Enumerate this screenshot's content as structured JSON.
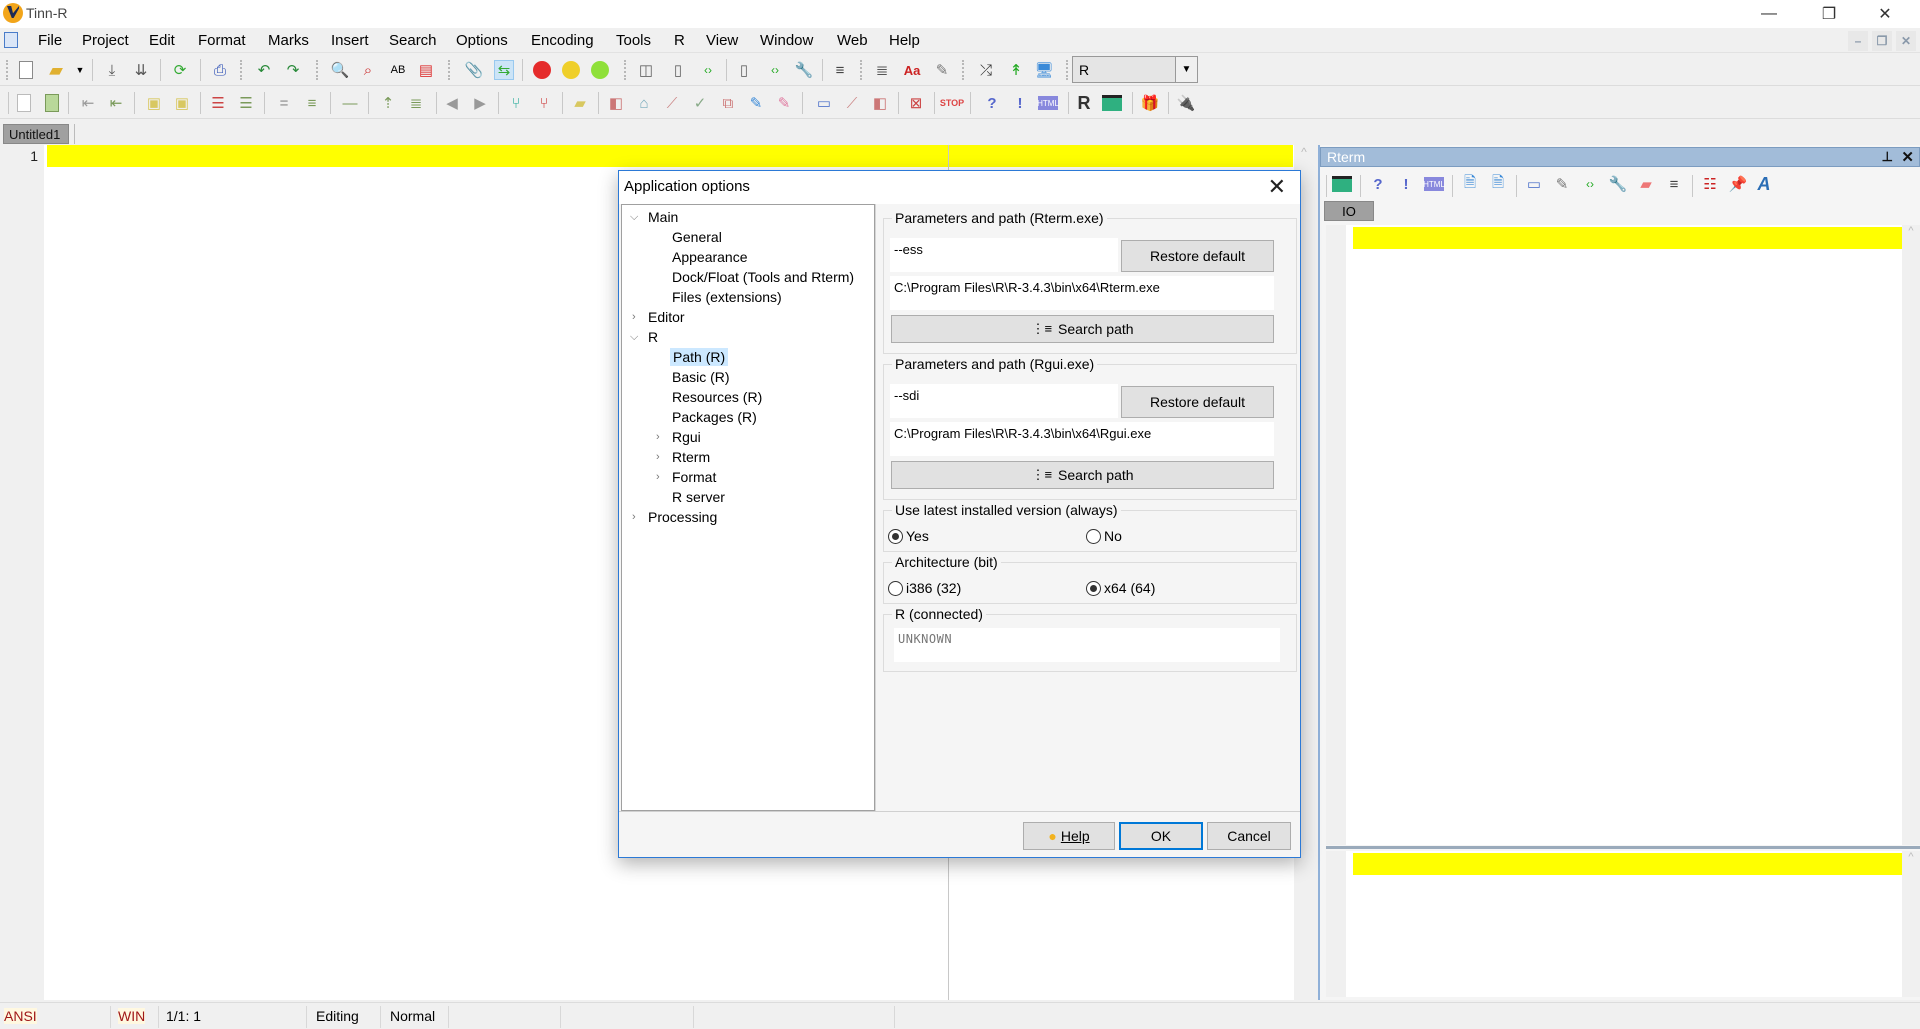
{
  "window": {
    "title": "Tinn-R",
    "minimize": "—",
    "restore": "❐",
    "close": "✕"
  },
  "menubar": {
    "items": [
      "File",
      "Project",
      "Edit",
      "Format",
      "Marks",
      "Insert",
      "Search",
      "Options",
      "Encoding",
      "Tools",
      "R",
      "View",
      "Window",
      "Web",
      "Help"
    ],
    "mdi": {
      "minimize": "–",
      "restore": "❐",
      "close": "✕"
    }
  },
  "toolbar1": {
    "r_combo_value": "R"
  },
  "tabs": [
    {
      "label": "Untitled1"
    }
  ],
  "editor": {
    "line_number": "1"
  },
  "rterm": {
    "title": "Rterm",
    "io_tab": "IO",
    "pin": "⊥",
    "close": "✕"
  },
  "statusbar": {
    "encoding": "ANSI",
    "eol": "WIN",
    "position": "1/1: 1",
    "mode": "Editing",
    "state": "Normal"
  },
  "dialog": {
    "title": "Application options",
    "tree": [
      {
        "label": "Main",
        "level": 0,
        "expanded": true
      },
      {
        "label": "General",
        "level": 1
      },
      {
        "label": "Appearance",
        "level": 1
      },
      {
        "label": "Dock/Float (Tools and Rterm)",
        "level": 1
      },
      {
        "label": "Files (extensions)",
        "level": 1
      },
      {
        "label": "Editor",
        "level": 0,
        "expanded": false
      },
      {
        "label": "R",
        "level": 0,
        "expanded": true
      },
      {
        "label": "Path (R)",
        "level": 1,
        "selected": true
      },
      {
        "label": "Basic (R)",
        "level": 1
      },
      {
        "label": "Resources (R)",
        "level": 1
      },
      {
        "label": "Packages (R)",
        "level": 1
      },
      {
        "label": "Rgui",
        "level": 1,
        "expanded": false
      },
      {
        "label": "Rterm",
        "level": 1,
        "expanded": false
      },
      {
        "label": "Format",
        "level": 1,
        "expanded": false
      },
      {
        "label": "R server",
        "level": 1
      },
      {
        "label": "Processing",
        "level": 0,
        "expanded": false
      }
    ],
    "rterm_group": {
      "label": "Parameters and path (Rterm.exe)",
      "params": "--ess",
      "restore_label": "Restore default",
      "path": "C:\\Program Files\\R\\R-3.4.3\\bin\\x64\\Rterm.exe",
      "search_label": "Search path"
    },
    "rgui_group": {
      "label": "Parameters and path (Rgui.exe)",
      "params": "--sdi",
      "restore_label": "Restore default",
      "path": "C:\\Program Files\\R\\R-3.4.3\\bin\\x64\\Rgui.exe",
      "search_label": "Search path"
    },
    "latest_group": {
      "label": "Use latest installed version (always)",
      "yes": "Yes",
      "no": "No",
      "selected": "Yes"
    },
    "arch_group": {
      "label": "Architecture (bit)",
      "opt32": "i386 (32)",
      "opt64": "x64 (64)",
      "selected": "x64 (64)"
    },
    "connected_group": {
      "label": "R (connected)",
      "value": "UNKNOWN"
    },
    "buttons": {
      "help": "Help",
      "ok": "OK",
      "cancel": "Cancel"
    }
  }
}
